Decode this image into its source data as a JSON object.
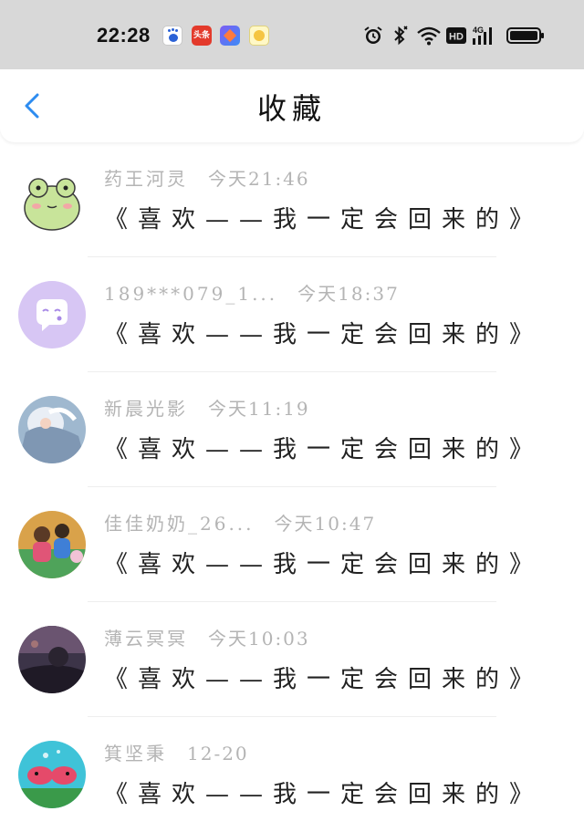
{
  "status_bar": {
    "time": "22:28",
    "app_icons": [
      "baidu-icon",
      "toutiao-icon",
      "diamond-app-icon",
      "emoji-app-icon"
    ],
    "toutiao_label": "头条",
    "right_icons": [
      "alarm-icon",
      "bluetooth-icon",
      "wifi-icon",
      "hd-icon",
      "signal-4g-icon",
      "battery-icon"
    ],
    "hd_label": "HD",
    "network_label": "4G"
  },
  "header": {
    "title": "收藏",
    "back_icon": "chevron-left-icon",
    "accent_color": "#2d8cf0"
  },
  "items": [
    {
      "name": "药王河灵",
      "time": "今天21:46",
      "content": "《喜欢——我一定会回来的》",
      "avatar": "frog"
    },
    {
      "name": "189***079_1...",
      "time": "今天18:37",
      "content": "《喜欢——我一定会回来的》",
      "avatar": "chat-bubble"
    },
    {
      "name": "新晨光影",
      "time": "今天11:19",
      "content": "《喜欢——我一定会回来的》",
      "avatar": "anime"
    },
    {
      "name": "佳佳奶奶_26...",
      "time": "今天10:47",
      "content": "《喜欢——我一定会回来的》",
      "avatar": "family"
    },
    {
      "name": "薄云冥冥",
      "time": "今天10:03",
      "content": "《喜欢——我一定会回来的》",
      "avatar": "dusk"
    },
    {
      "name": "箕坚秉",
      "time": "12-20",
      "content": "《喜欢——我一定会回来的》",
      "avatar": "fish"
    }
  ]
}
